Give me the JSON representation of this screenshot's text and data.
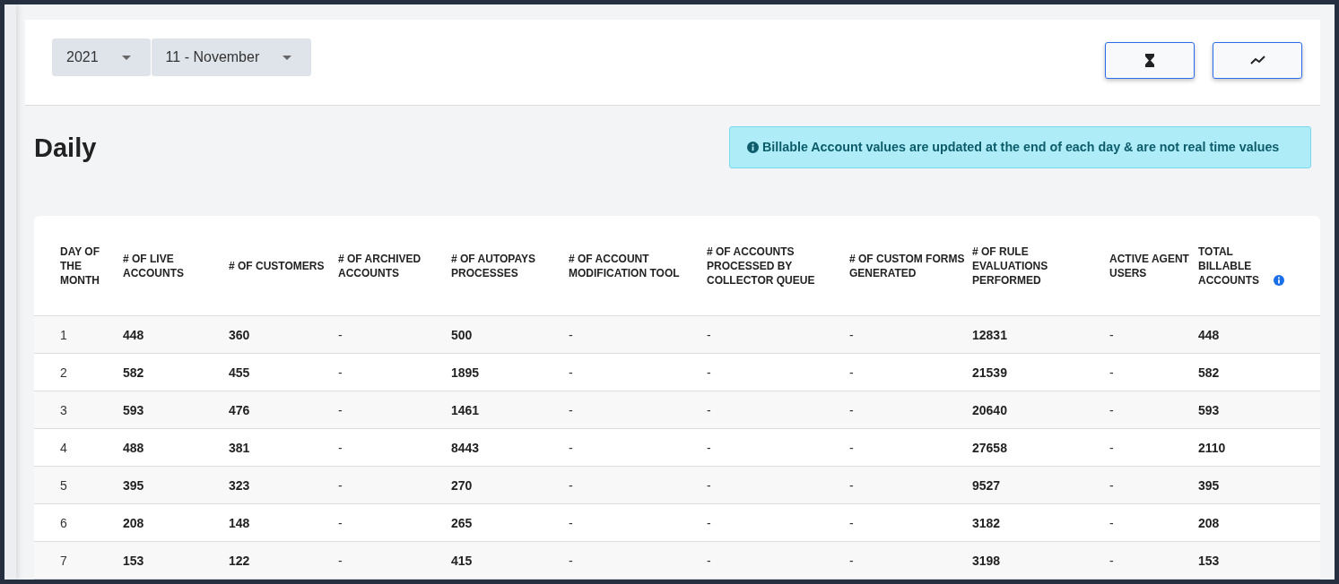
{
  "filters": [
    {
      "value": "2021"
    },
    {
      "value": "11 - November"
    }
  ],
  "toolbar_buttons": [
    {
      "kind": "hourglass"
    },
    {
      "kind": "trend"
    }
  ],
  "title": "Daily",
  "notice": "Billable Account values are updated at the end of each day & are not real time values",
  "table": {
    "columns": [
      {
        "label": "DAY OF THE MONTH",
        "bold": false,
        "info": false
      },
      {
        "label": "# OF LIVE ACCOUNTS",
        "bold": true,
        "info": false
      },
      {
        "label": "# OF CUSTOMERS",
        "bold": true,
        "info": false
      },
      {
        "label": "# OF ARCHIVED ACCOUNTS",
        "bold": false,
        "info": false
      },
      {
        "label": "# OF AUTOPAYS PROCESSES",
        "bold": true,
        "info": false
      },
      {
        "label": "# OF ACCOUNT MODIFICATION TOOL",
        "bold": false,
        "info": false
      },
      {
        "label": "# OF ACCOUNTS PROCESSED BY COLLECTOR QUEUE",
        "bold": false,
        "info": false
      },
      {
        "label": "# OF CUSTOM FORMS GENERATED",
        "bold": false,
        "info": false
      },
      {
        "label": "# OF RULE EVALUATIONS PERFORMED",
        "bold": true,
        "info": false
      },
      {
        "label": "ACTIVE AGENT USERS",
        "bold": false,
        "info": false
      },
      {
        "label": "TOTAL BILLABLE ACCOUNTS",
        "bold": true,
        "info": true
      }
    ],
    "rows": [
      [
        "1",
        "448",
        "360",
        "-",
        "500",
        "-",
        "-",
        "-",
        "12831",
        "-",
        "448"
      ],
      [
        "2",
        "582",
        "455",
        "-",
        "1895",
        "-",
        "-",
        "-",
        "21539",
        "-",
        "582"
      ],
      [
        "3",
        "593",
        "476",
        "-",
        "1461",
        "-",
        "-",
        "-",
        "20640",
        "-",
        "593"
      ],
      [
        "4",
        "488",
        "381",
        "-",
        "8443",
        "-",
        "-",
        "-",
        "27658",
        "-",
        "2110"
      ],
      [
        "5",
        "395",
        "323",
        "-",
        "270",
        "-",
        "-",
        "-",
        "9527",
        "-",
        "395"
      ],
      [
        "6",
        "208",
        "148",
        "-",
        "265",
        "-",
        "-",
        "-",
        "3182",
        "-",
        "208"
      ],
      [
        "7",
        "153",
        "122",
        "-",
        "415",
        "-",
        "-",
        "-",
        "3198",
        "-",
        "153"
      ]
    ]
  }
}
